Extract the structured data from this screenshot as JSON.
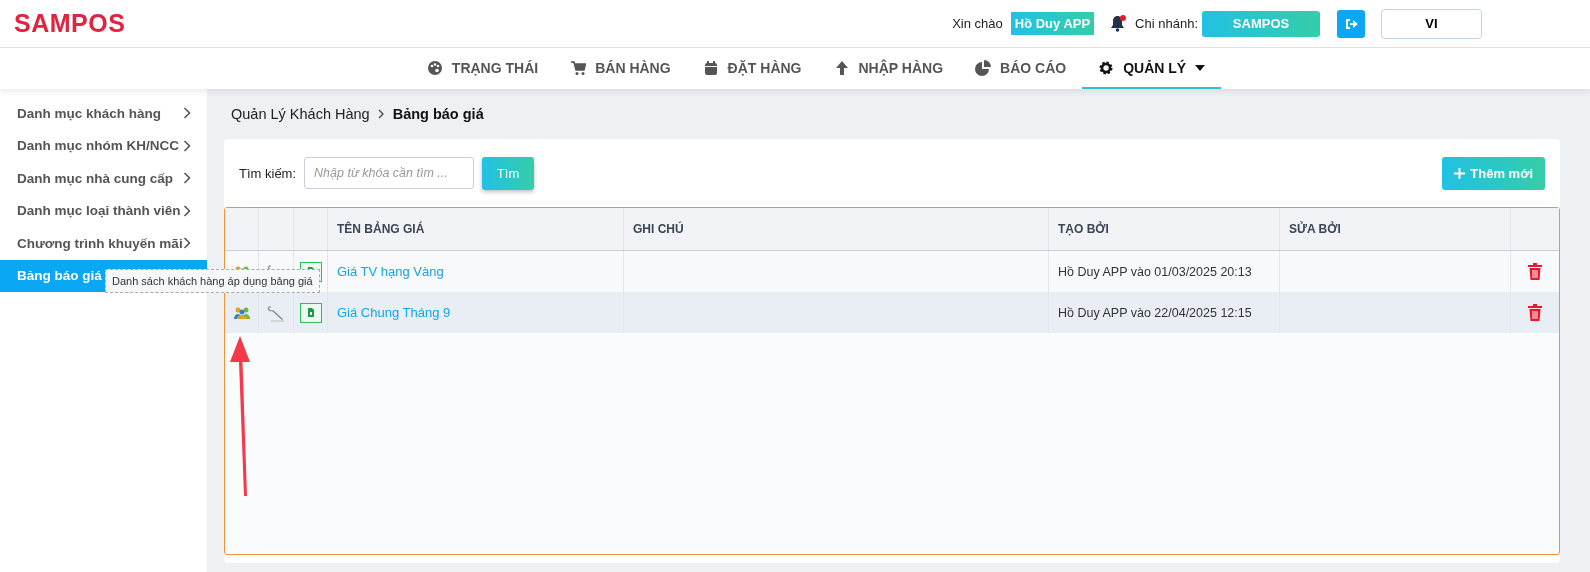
{
  "header": {
    "logo": "SAMPOS",
    "greeting": "Xin chào",
    "user": "Hồ Duy APP",
    "notification": true,
    "branch_label": "Chi nhánh:",
    "branch": "SAMPOS",
    "language": "VI"
  },
  "nav": [
    {
      "label": "TRẠNG THÁI",
      "selected": false
    },
    {
      "label": "BÁN HÀNG",
      "selected": false
    },
    {
      "label": "ĐẶT HÀNG",
      "selected": false
    },
    {
      "label": "NHẬP HÀNG",
      "selected": false
    },
    {
      "label": "BÁO CÁO",
      "selected": false
    },
    {
      "label": "QUẢN LÝ",
      "selected": true
    }
  ],
  "sidebar": {
    "items": [
      {
        "label": "Danh mục khách hàng",
        "selected": false
      },
      {
        "label": "Danh mục nhóm KH/NCC",
        "selected": false
      },
      {
        "label": "Danh mục nhà cung cấp",
        "selected": false
      },
      {
        "label": "Danh mục loại thành viên",
        "selected": false
      },
      {
        "label": "Chương trình khuyến mãi",
        "selected": false
      },
      {
        "label": "Bảng báo giá",
        "selected": true
      }
    ]
  },
  "breadcrumb": [
    "Quản Lý Khách Hàng",
    "Bảng báo giá"
  ],
  "search": {
    "label": "Tìm kiếm:",
    "placeholder": "Nhập từ khóa cần tìm ...",
    "button": "Tìm"
  },
  "add_button": "Thêm mới",
  "table": {
    "columns": [
      "TÊN BẢNG GIÁ",
      "GHI CHÚ",
      "TẠO BỞI",
      "SỬA BỞI"
    ],
    "rows": [
      {
        "name": "Giá TV hạng Vàng",
        "note": "",
        "created_by": "Hồ Duy APP vào 01/03/2025 20:13",
        "selected": false
      },
      {
        "name": "Giá Chung Tháng 9",
        "note": "",
        "created_by": "Hồ Duy APP vào 22/04/2025 12:15",
        "selected": true
      }
    ]
  },
  "tooltip": "Danh sách khách hàng áp dụng bảng giá"
}
